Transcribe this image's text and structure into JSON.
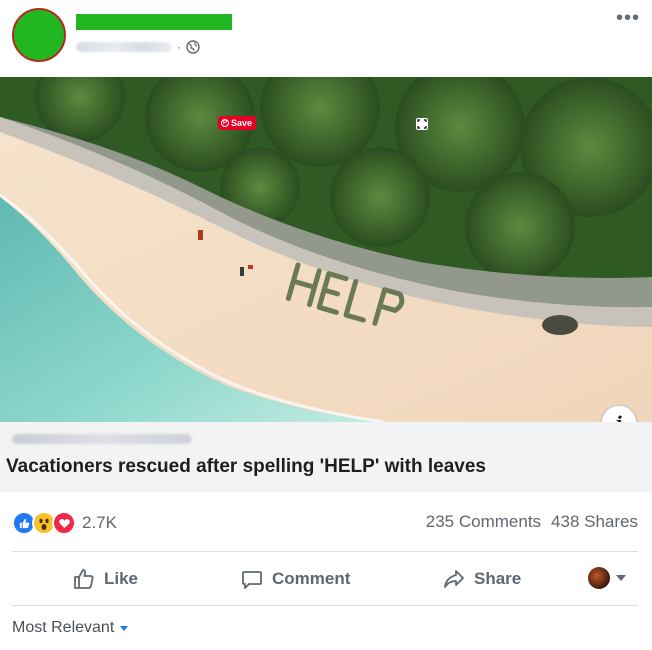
{
  "header": {
    "more_icon": "more-horizontal-icon",
    "privacy_icon": "globe-icon",
    "separator": "·"
  },
  "media": {
    "save_label": "Save",
    "painted_word": "HELP",
    "info_label": "i",
    "colors": {
      "save_button": "#e60023",
      "forest": "#2f5a24",
      "sand": "#f1dcc2",
      "water": "#7ccfc6"
    }
  },
  "link_preview": {
    "headline": "Vacationers rescued after spelling 'HELP' with leaves"
  },
  "reactions": {
    "types": [
      "like-reaction-icon",
      "wow-reaction-icon",
      "love-reaction-icon"
    ],
    "count": "2.7K",
    "comments": "235 Comments",
    "shares": "438 Shares"
  },
  "actions": {
    "like": "Like",
    "comment": "Comment",
    "share": "Share"
  },
  "comments_sort": {
    "label": "Most Relevant"
  },
  "colors": {
    "accent": "#1877f2",
    "placeholder_green": "#22b622",
    "avatar_border": "#b52a1f"
  }
}
